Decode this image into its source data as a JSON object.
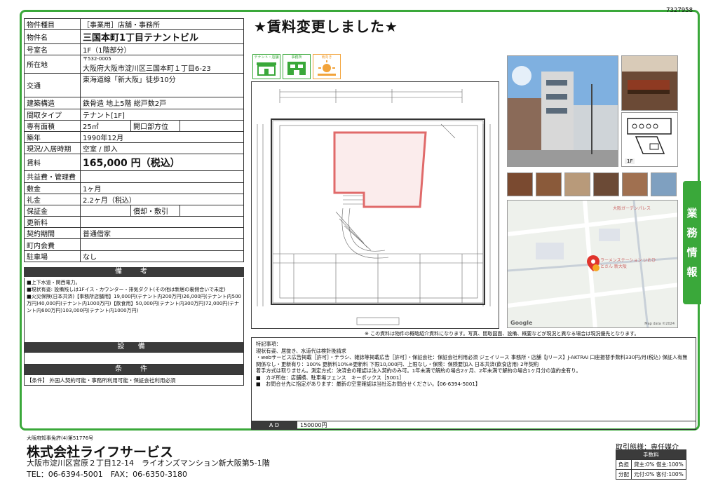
{
  "doc_id": "7327958",
  "headline": "★賃料変更しました★",
  "property": [
    {
      "k": "物件種目",
      "v": "［事業用］店舗・事務所",
      "style": ""
    },
    {
      "k": "物件名",
      "v": "三国本町1丁目テナントビル",
      "style": "big"
    },
    {
      "k": "号室名",
      "v": "1F（1階部分）",
      "style": ""
    },
    {
      "k": "所在地",
      "v": "大阪府大阪市淀川区三国本町１丁目6-23",
      "postal": "〒532-0005",
      "style": "addr"
    },
    {
      "k": "交通",
      "v": "東海道線「新大阪」徒歩10分",
      "style": "tall"
    },
    {
      "k": "建築構造",
      "v": "鉄骨造 地上5階 総戸数2戸",
      "style": ""
    },
    {
      "k": "間取タイプ",
      "v": "テナント[1F]",
      "style": ""
    },
    {
      "k": "専有面積",
      "v": "25㎡",
      "k2": "開口部方位",
      "v2": "",
      "style": "split"
    },
    {
      "k": "築年",
      "v": "1990年12月",
      "style": ""
    },
    {
      "k": "現況/入居時期",
      "v": "空室 / 即入",
      "style": ""
    },
    {
      "k": "賃料",
      "v": "165,000 円（税込）",
      "style": "rent"
    },
    {
      "k": "共益費・管理費",
      "v": "",
      "style": ""
    },
    {
      "k": "敷金",
      "v": "1ヶ月",
      "style": ""
    },
    {
      "k": "礼金",
      "v": "2.2ヶ月（税込）",
      "style": ""
    },
    {
      "k": "保証金",
      "v": "",
      "k2": "償却・敷引",
      "v2": "",
      "style": "split"
    },
    {
      "k": "更新料",
      "v": "",
      "style": ""
    },
    {
      "k": "契約期間",
      "v": "普通借家",
      "style": ""
    },
    {
      "k": "町内会費",
      "v": "",
      "style": ""
    },
    {
      "k": "駐車場",
      "v": "なし",
      "style": ""
    }
  ],
  "sections": {
    "remarks_title": "備　考",
    "equipment_title": "設 備",
    "conditions_title": "条　件"
  },
  "remarks": [
    "■上下水道・関西電力。",
    "■現状有姿: 設備残しは1Fイス・カウンター・排気ダクト(その他は新居の裏側合いで未定)",
    "■火災保険(日本共済)【事務所店舗用】19,000円(テナント内200万円)26,000円(テナント内500万円)40,000円(テナント内1000万円)【飲食用】50,000円(テナント内300万円)72,000円(テナント内600万円)103,000円(テナント内1000万円)"
  ],
  "conditions": "【条件】 外国人契約可能・事務所利用可能・保証会社利用必須",
  "badges": [
    {
      "label": "テナント・店舗",
      "icon": "shop-icon"
    },
    {
      "label": "事務所",
      "icon": "office-icon"
    },
    {
      "label": "南向き",
      "icon": "sun-icon"
    }
  ],
  "plan_tag": "1F",
  "side_tab": [
    "業",
    "務",
    "情",
    "報"
  ],
  "map_labels": {
    "poi1": "ラーメンステーション いおひとさん 新大阪",
    "poi2": "大阪ガーデンパレス",
    "credit": "Google",
    "copyright": "Map data ©2024"
  },
  "disclaimer": "※ この資料は物件の概略紹介資料になります。写真、間取図面、設備、概要などが現況と異なる場合は現況優先となります。",
  "special_title": "特記事項：",
  "special_lines": [
    "現状有姿、居抜き、水道代は検針後請求",
    "・webサービス広告掲載［許可］・チラシ、雑誌等掲載広告［許可］・保証会社：保証会社利用必須 ジェイリース 事務所・店舗【Jリース】J-AKTRAI 口座振替手数料330円/月(税込) 保証人有無関係なし・更新有り：100% 更新料10%※更新料 下限10,000円、上限なし・保険：保険要加入 日本共済(飲食店用) 2年契約",
    "着手方式は取りません。測定方式：決済金の確認は法入契約のみ可。1年未満で解約の場合2ヶ月、2年未満で解約の場合1ヶ月分の違約金有り。",
    "■　カギ所在：店舗横、駐車場フェンス　キーボックス［5001］",
    "■　お問合せ先に指定があります：最新の空室確認は当社迄お問合せください。【06-6394-5001】"
  ],
  "ad_label": "A D",
  "ad_value": "150000円",
  "footer": {
    "license": "大阪府知事免許(4)第51776号",
    "company": "株式会社ライフサービス",
    "address": "大阪市淀川区宮原２丁目12-14　ライオンズマンション新大阪第5-1階",
    "tel": "TEL：06-6394-5001　FAX：06-6350-3180",
    "mode": "取引態様：専任媒介",
    "fee_title": "手数料",
    "fee_rows": [
      {
        "k": "負担",
        "v": "貸主:0% 借主:100%"
      },
      {
        "k": "分配",
        "v": "元付:0% 客付:100%"
      }
    ]
  },
  "colors": {
    "accent": "#3aa83a",
    "dark": "#3b3b3b",
    "plan_highlight": "#e06a6a"
  }
}
